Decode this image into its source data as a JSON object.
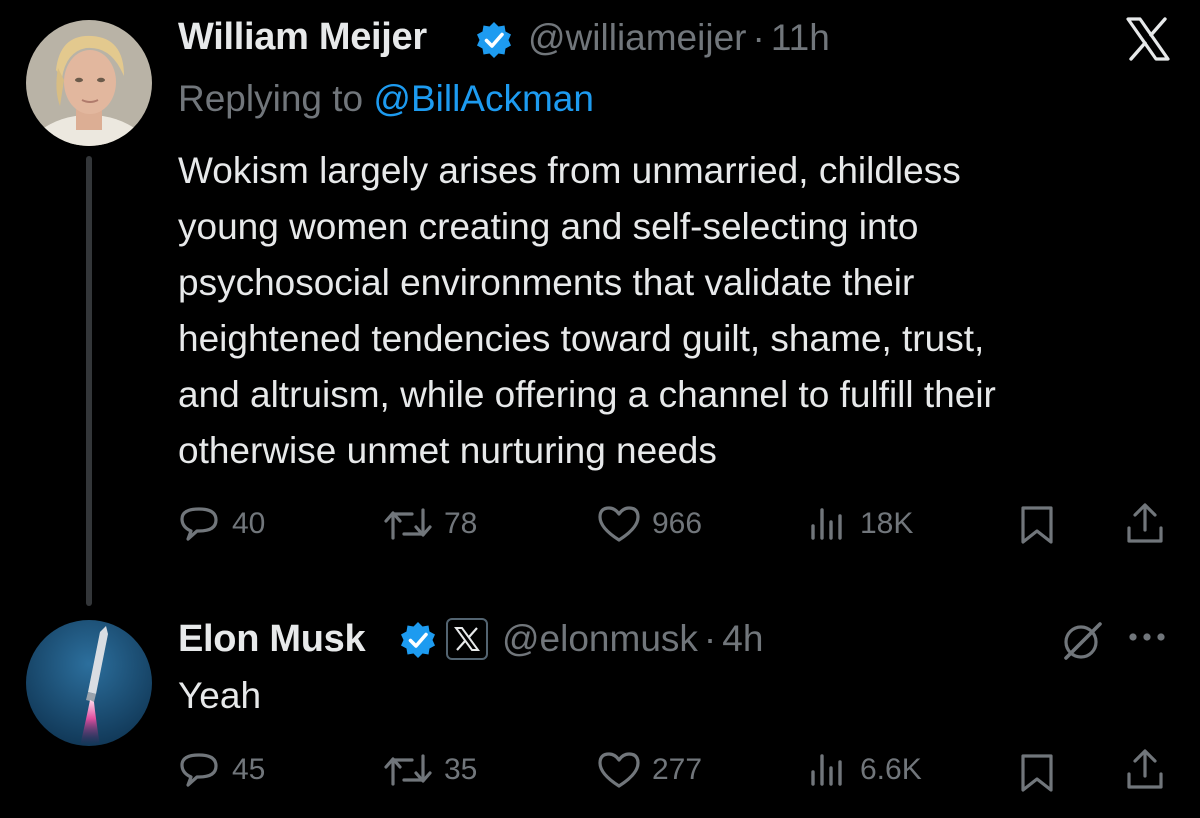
{
  "colors": {
    "background": "#000000",
    "text_primary": "#e7e9ea",
    "text_secondary": "#71767b",
    "link": "#1d9bf0",
    "verified": "#1d9bf0",
    "thread_line": "#333639"
  },
  "close_icon": "x-logo-icon",
  "tweet1": {
    "author_name": "William Meijer",
    "handle": "@williameijer",
    "separator": "·",
    "time": "11h",
    "replying_prefix": "Replying to",
    "replying_to": "@BillAckman",
    "lines": [
      "Wokism largely arises from unmarried, childless",
      "young women creating and self-selecting into",
      "psychosocial environments that validate their",
      "heightened tendencies toward guilt, shame, trust,",
      "and altruism, while offering a channel to fulfill their",
      "otherwise unmet nurturing needs"
    ],
    "stats": {
      "replies": "40",
      "reposts": "78",
      "likes": "966",
      "views": "18K"
    }
  },
  "tweet2": {
    "author_name": "Elon Musk",
    "handle": "@elonmusk",
    "separator": "·",
    "time": "4h",
    "text": "Yeah",
    "stats": {
      "replies": "45",
      "reposts": "35",
      "likes": "277",
      "views": "6.6K"
    }
  }
}
